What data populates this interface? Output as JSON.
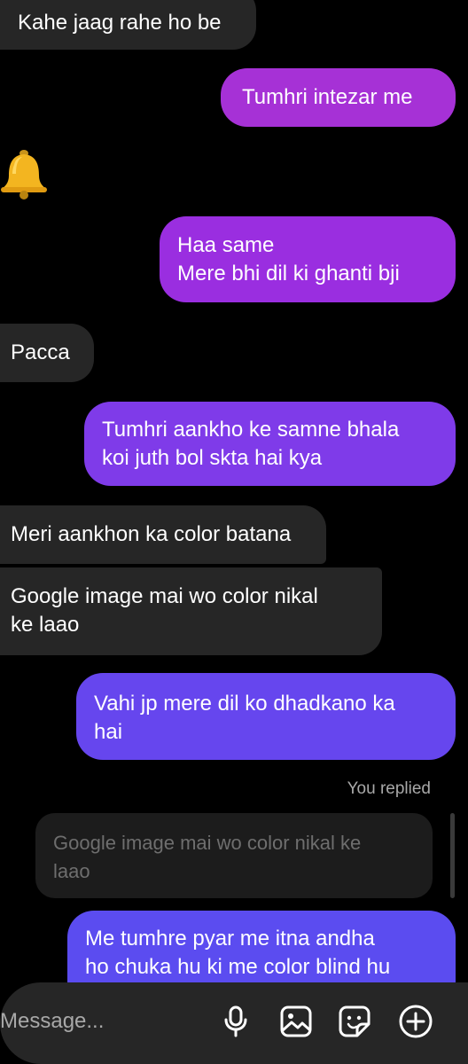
{
  "conversation": {
    "messages": [
      {
        "direction": "incoming",
        "text": "Kahe jaag rahe ho be"
      },
      {
        "direction": "outgoing",
        "text": "Tumhri intezar me",
        "color": "#a631d6"
      },
      {
        "direction": "incoming",
        "emoji": "bell"
      },
      {
        "direction": "outgoing",
        "text": "Haa same\nMere bhi dil ki ghanti bji",
        "color": "#9a2ee0"
      },
      {
        "direction": "incoming",
        "text": "Pacca"
      },
      {
        "direction": "outgoing",
        "text": "Tumhri aankho ke samne bhala\nkoi juth bol skta hai kya",
        "color": "#7f3be9"
      },
      {
        "direction": "incoming",
        "text": "Meri aankhon ka color batana"
      },
      {
        "direction": "incoming",
        "text": "Google image mai wo color nikal\nke laao"
      },
      {
        "direction": "outgoing",
        "text": "Vahi jp mere dil ko dhadkano ka\nhai",
        "color": "#6646ee"
      },
      {
        "direction": "outgoing",
        "text": "Me tumhre pyar me itna andha\nho chuka hu ki me color blind hu",
        "color": "#5b4cf0"
      }
    ],
    "reply": {
      "label": "You replied",
      "quoted_text": "Google image mai wo color nikal ke\nlaao"
    }
  },
  "composer": {
    "placeholder": "Message...",
    "icons": [
      "microphone-icon",
      "gallery-icon",
      "sticker-icon",
      "add-icon"
    ]
  },
  "colors": {
    "background": "#000000",
    "incoming_bubble": "#262626",
    "text": "#ffffff",
    "muted_text": "#a8a8a8"
  }
}
